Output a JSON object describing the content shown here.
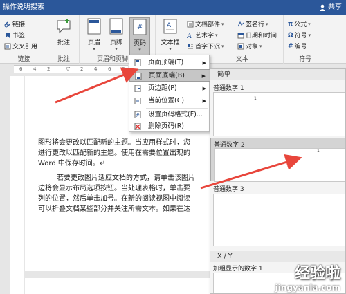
{
  "titlebar": {
    "search": "操作说明搜索",
    "share": "共享"
  },
  "ribbon": {
    "links": {
      "items": [
        "链接",
        "书签",
        "交叉引用"
      ],
      "label": "链接"
    },
    "comments": {
      "button": "批注",
      "label": "批注"
    },
    "header_footer": {
      "buttons": [
        "页眉",
        "页脚",
        "页码"
      ],
      "label": "页眉和页脚"
    },
    "text": {
      "textbox": "文本框",
      "items": [
        "文档部件",
        "艺术字",
        "首字下沉",
        "签名行",
        "日期和时间",
        "对象"
      ],
      "label": "文本"
    },
    "symbols": {
      "items": [
        "公式",
        "符号",
        "编号"
      ],
      "label": "符号"
    }
  },
  "ruler": {
    "numbers": [
      "6",
      "4",
      "2",
      "2",
      "4",
      "6",
      "8"
    ]
  },
  "document": {
    "lines": [
      "图形将会更改以匹配新的主题。当应用样式时，您",
      "进行更改以匹配新的主题。使用在需要位置出现的",
      "Word 中保存时间。↵",
      "若要更改图片适应文档的方式，请单击该图片",
      "边将会显示布局选项按钮。当处理表格时，单击要",
      "列的位置，然后单击加号。在新的阅读视图中阅读",
      "可以折叠文档某些部分并关注所需文本。如果在达"
    ]
  },
  "menu": {
    "items": [
      {
        "label": "页面顶端(T)",
        "has_sub": true
      },
      {
        "label": "页面底端(B)",
        "has_sub": true,
        "selected": true
      },
      {
        "label": "页边距(P)",
        "has_sub": true
      },
      {
        "label": "当前位置(C)",
        "has_sub": true
      },
      {
        "label": "设置页码格式(F)...",
        "has_sub": false
      },
      {
        "label": "删除页码(R)",
        "has_sub": false
      }
    ]
  },
  "gallery": {
    "section1": "简单",
    "item1": "普通数字 1",
    "item2": "普通数字 2",
    "item3": "普通数字 3",
    "section2": "X / Y",
    "item4": "加粗显示的数字 1",
    "page_number": "1"
  },
  "watermark": {
    "line1": "经验啦",
    "line2": "jingyanla.com"
  },
  "colors": {
    "titlebar": "#2b579a",
    "arrow": "#e8463c",
    "selected": "#c6c6c6"
  }
}
